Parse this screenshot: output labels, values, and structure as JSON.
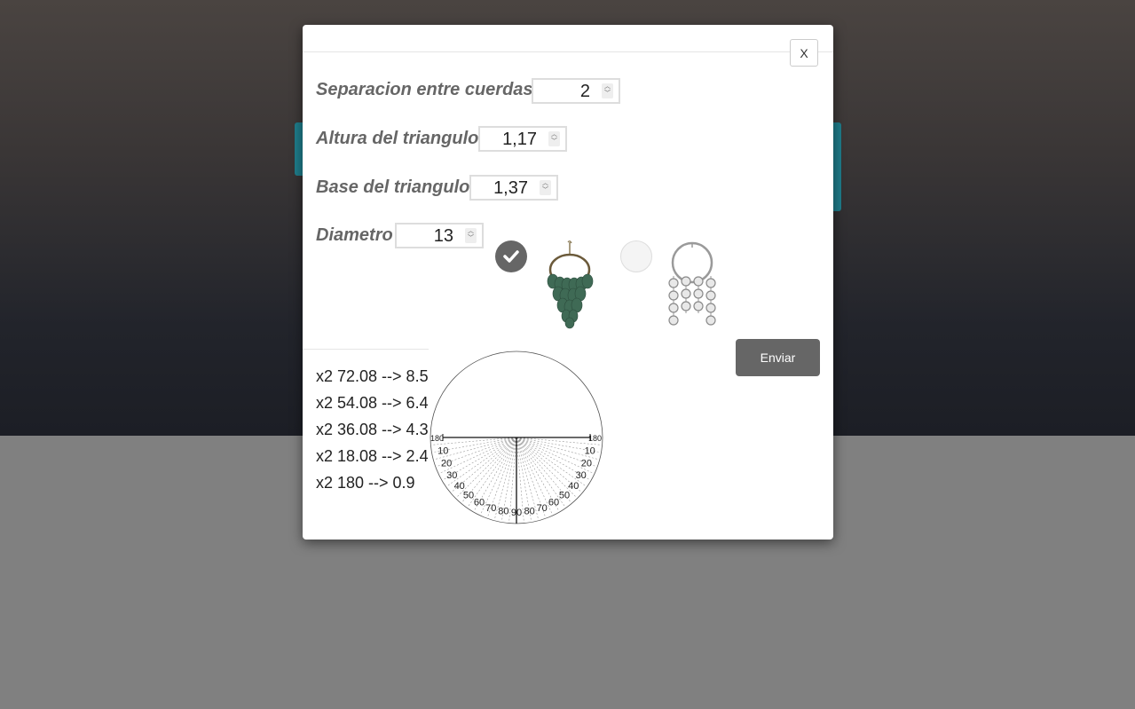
{
  "modal": {
    "close_label": "X",
    "fields": {
      "separacion": {
        "label": "Separacion entre cuerdas",
        "value": "2"
      },
      "altura": {
        "label": "Altura del triangulo",
        "value": "1,17"
      },
      "base": {
        "label": "Base del triangulo",
        "value": "1,37"
      },
      "diametro": {
        "label": "Diametro",
        "value": "13"
      }
    },
    "earring_options": [
      {
        "name": "green-leaf-chandelier-earring",
        "selected": true
      },
      {
        "name": "silver-hoop-disc-earring",
        "selected": false
      }
    ],
    "submit_label": "Enviar",
    "results": [
      "x2 72.08 --> 8.5",
      "x2 54.08 --> 6.4",
      "x2 36.08 --> 4.3",
      "x2 18.08 --> 2.4",
      "x2 180 --> 0.9"
    ],
    "protractor": {
      "edge_labels": [
        "180",
        "180"
      ],
      "left_labels": [
        "10",
        "20",
        "30",
        "40",
        "50",
        "60",
        "70",
        "80"
      ],
      "center_label": "90",
      "right_labels": [
        "80",
        "70",
        "60",
        "50",
        "40",
        "30",
        "20",
        "10"
      ]
    }
  },
  "colors": {
    "modal_bg": "#ffffff",
    "button_bg": "#666666",
    "label_color": "#666666",
    "overlay_bottom": "#808080",
    "teal_accent": "#1f7d8b"
  }
}
